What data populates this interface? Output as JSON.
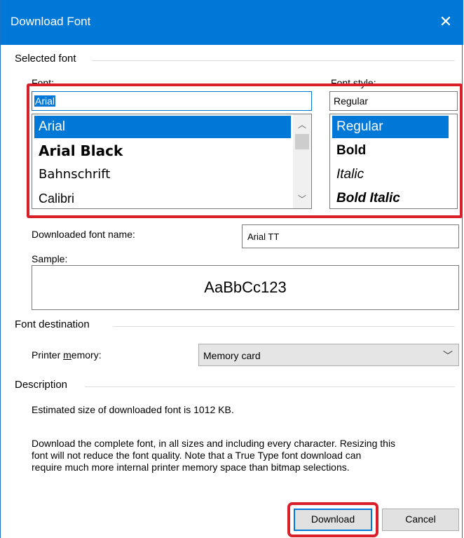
{
  "window": {
    "title": "Download Font",
    "close_glyph": "✕"
  },
  "selected_font": {
    "group_label": "Selected font",
    "font_label": "Font:",
    "font_value": "Arial",
    "fonts": [
      "Arial",
      "Arial Black",
      "Bahnschrift",
      "Calibri"
    ],
    "selected_font_index": 0,
    "style_label": "Font style:",
    "style_value": "Regular",
    "styles": [
      "Regular",
      "Bold",
      "Italic",
      "Bold Italic"
    ],
    "selected_style_index": 0,
    "downloaded_name_label": "Downloaded font name:",
    "downloaded_name_value": "Arial TT",
    "sample_label": "Sample:",
    "sample_text": "AaBbCc123"
  },
  "destination": {
    "group_label": "Font destination",
    "printer_memory_label": "Printer memory:",
    "printer_memory_value": "Memory card"
  },
  "description": {
    "group_label": "Description",
    "size_text": "Estimated size of downloaded font is 1012 KB.",
    "lines": [
      "Download the complete font, in all sizes and including every character. Resizing this",
      "font will not reduce the font quality. Note that a True Type font download can",
      "require much more internal printer memory space than bitmap selections."
    ]
  },
  "buttons": {
    "download_label": "Download",
    "cancel_label": "Cancel"
  },
  "colors": {
    "accent": "#0078d7",
    "highlight_box": "#d9202a"
  }
}
